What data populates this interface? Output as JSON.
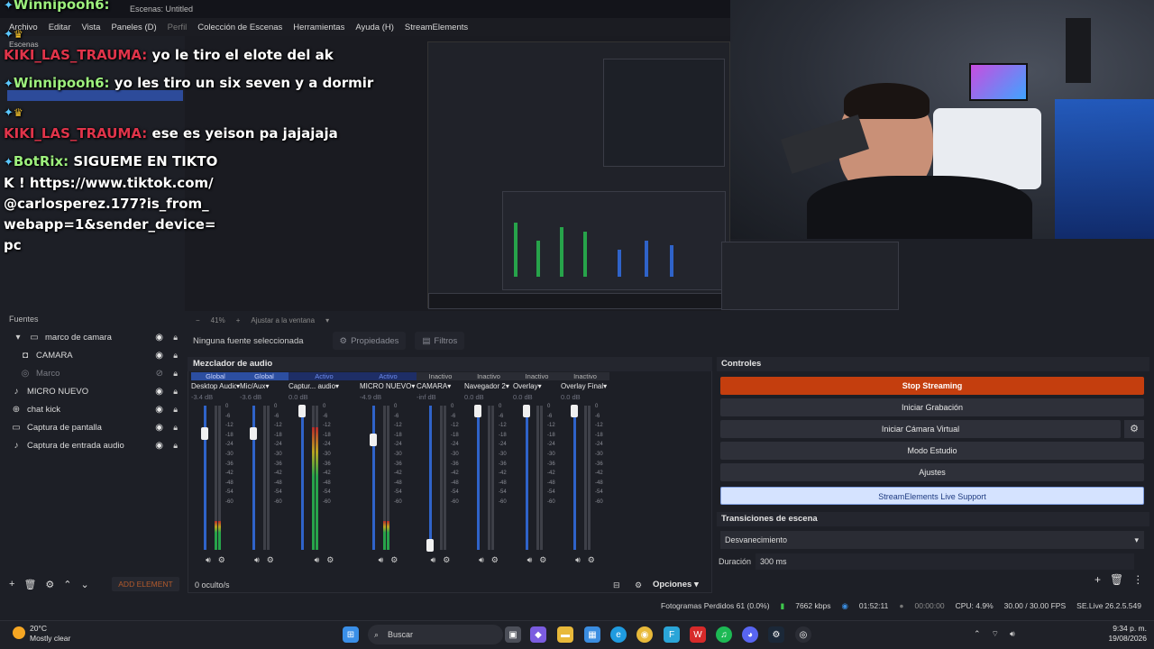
{
  "window": {
    "title": "Escenas: Untitled"
  },
  "menu": {
    "items": [
      "Archivo",
      "Editar",
      "Vista",
      "Paneles (D)",
      "Perfil",
      "Colección de Escenas",
      "Herramientas",
      "Ayuda (H)",
      "StreamElements"
    ]
  },
  "chat": {
    "messages": [
      {
        "user": "Winnipooh6:",
        "text": "",
        "color": "#8fd3ff"
      },
      {
        "user": "KIKI_LAS_TRAUMA:",
        "text": "yo le tiro el elote del ak",
        "color": "#e0344a"
      },
      {
        "user": "Winnipooh6:",
        "text": "yo les tiro un six seven y a dormir",
        "color": "#8fd3ff"
      },
      {
        "user": "KIKI_LAS_TRAUMA:",
        "text": "ese es yeison pa jajajaja",
        "color": "#e0344a"
      },
      {
        "user": "BotRix:",
        "text": "SIGUEME EN TIKTOK ! https://www.tiktok.com/@carlosperez.177?is_from_webapp=1&sender_device=pc",
        "color": "#9df07d"
      }
    ]
  },
  "docks": {
    "scenes_label": "Escenas",
    "sources_label": "Fuentes"
  },
  "sources": {
    "items": [
      {
        "label": "marco de camara",
        "icon": "folder-icon",
        "visible": true,
        "locked": true,
        "expanded": true
      },
      {
        "label": "CAMARA",
        "icon": "camera-icon",
        "visible": true,
        "locked": true
      },
      {
        "label": "Marco",
        "icon": "image-icon",
        "visible": false,
        "locked": true
      },
      {
        "label": "MICRO NUEVO",
        "icon": "mic-icon",
        "visible": true,
        "locked": true
      },
      {
        "label": "chat kick",
        "icon": "globe-icon",
        "visible": true,
        "locked": true
      },
      {
        "label": "Captura de pantalla",
        "icon": "monitor-icon",
        "visible": true,
        "locked": true
      },
      {
        "label": "Captura de entrada audio",
        "icon": "mic-icon",
        "visible": true,
        "locked": true
      }
    ],
    "add_element": "ADD ELEMENT"
  },
  "preview": {
    "zoom": "41%",
    "fit_label": "Ajustar a la ventana"
  },
  "source_toolbar": {
    "no_source": "Ninguna fuente seleccionada",
    "properties": "Propiedades",
    "filters": "Filtros"
  },
  "mixer": {
    "title": "Mezclador de audio",
    "hidden_count": "0 oculto/s",
    "options_label": "Opciones",
    "scale": [
      "0",
      "-6",
      "-12",
      "-18",
      "-24",
      "-30",
      "-36",
      "-42",
      "-48",
      "-54",
      "-60"
    ],
    "channels": [
      {
        "status": "Global",
        "kind": "global",
        "name": "Desktop Audio",
        "db": "-3.4 dB",
        "level": 0.2
      },
      {
        "status": "Global",
        "kind": "global",
        "name": "Mic/Aux",
        "db": "-3.6 dB",
        "level": 0.0
      },
      {
        "status": "Activo",
        "kind": "active",
        "name": "Captur... audio",
        "db": "0.0 dB",
        "level": 0.85
      },
      {
        "status": "Activo",
        "kind": "active",
        "name": "MICRO NUEVO",
        "db": "-4.9 dB",
        "level": 0.2
      },
      {
        "status": "Inactivo",
        "kind": "inactive",
        "name": "CAMARA",
        "db": "-inf dB",
        "level": 0.0
      },
      {
        "status": "Inactivo",
        "kind": "inactive",
        "name": "Navegador 2",
        "db": "0.0 dB",
        "level": 0.0
      },
      {
        "status": "Inactivo",
        "kind": "inactive",
        "name": "Overlay",
        "db": "0.0 dB",
        "level": 0.0
      },
      {
        "status": "Inactivo",
        "kind": "inactive",
        "name": "Overlay Final",
        "db": "0.0 dB",
        "level": 0.0
      }
    ]
  },
  "controls": {
    "title": "Controles",
    "stop_streaming": "Stop Streaming",
    "start_recording": "Iniciar Grabación",
    "virtual_camera": "Iniciar Cámara Virtual",
    "studio_mode": "Modo Estudio",
    "settings": "Ajustes",
    "se_support": "StreamElements Live Support"
  },
  "transitions": {
    "title": "Transiciones de escena",
    "selected": "Desvanecimiento",
    "duration_label": "Duración",
    "duration_value": "300 ms"
  },
  "status": {
    "dropped": "Fotogramas Perdidos 61 (0.0%)",
    "bitrate": "7662 kbps",
    "live_time": "01:52:11",
    "rec_time": "00:00:00",
    "cpu": "CPU: 4.9%",
    "fps": "30.00 / 30.00 FPS",
    "version": "SE.Live 26.2.5.549"
  },
  "taskbar": {
    "temperature": "20°C",
    "weather": "Mostly clear",
    "search_placeholder": "Buscar",
    "time": "9:34 p. m.",
    "date": "19/08/2026"
  },
  "colors": {
    "accent_stream": "#c43e0e",
    "global_badge": "#2c4ea0",
    "meter_green": "#27a34a",
    "meter_yellow": "#b9a421",
    "meter_red": "#b72a2a"
  }
}
